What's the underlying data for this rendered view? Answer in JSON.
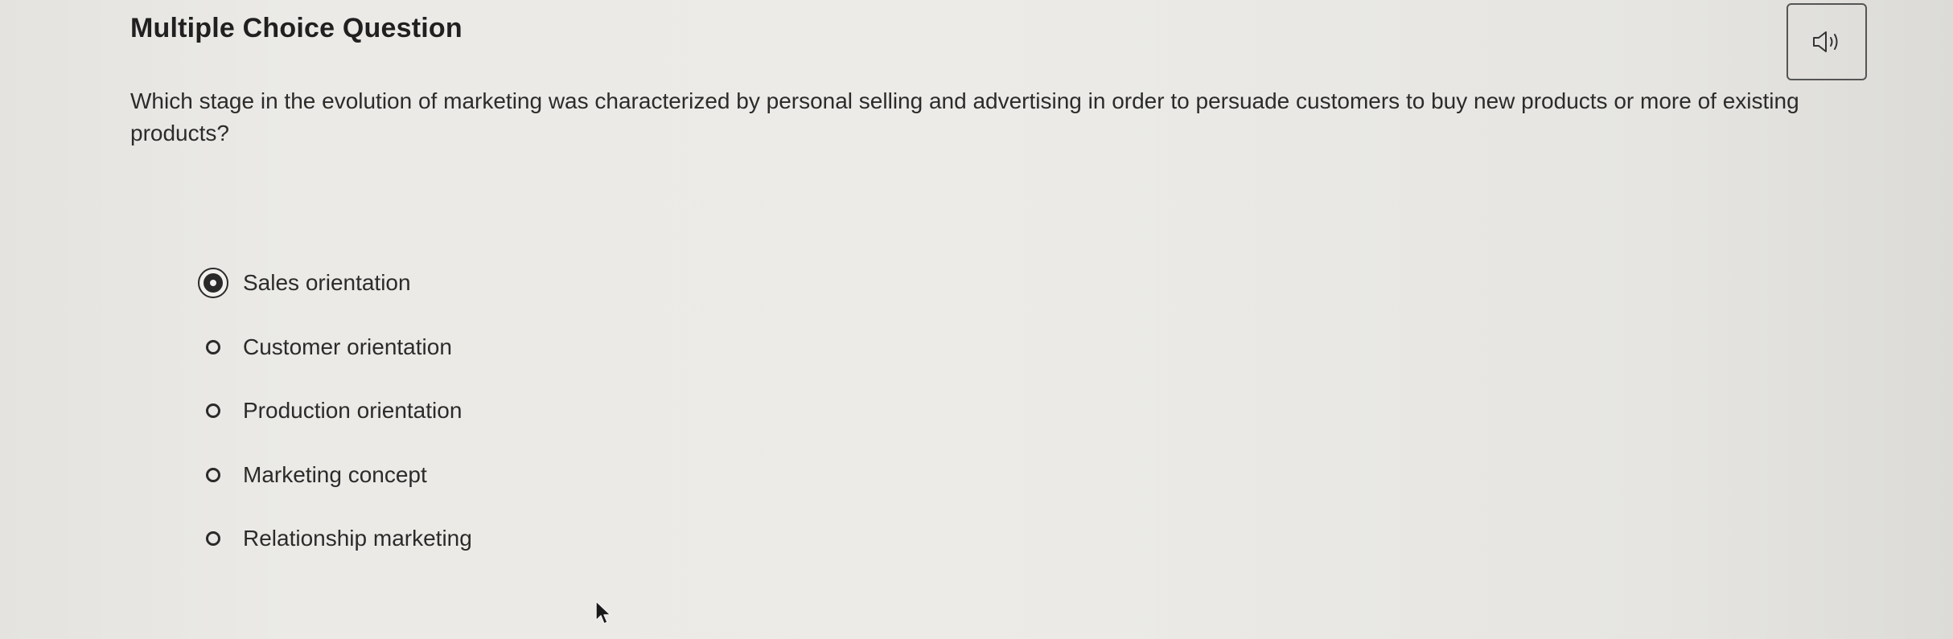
{
  "header": {
    "title": "Multiple Choice Question",
    "audio_icon": "speaker-icon"
  },
  "question": {
    "text": "Which stage in the evolution of marketing was characterized by personal selling and advertising in order to persuade customers to buy new products or more of existing products?"
  },
  "options": [
    {
      "label": "Sales orientation",
      "selected": true
    },
    {
      "label": "Customer orientation",
      "selected": false
    },
    {
      "label": "Production orientation",
      "selected": false
    },
    {
      "label": "Marketing concept",
      "selected": false
    },
    {
      "label": "Relationship marketing",
      "selected": false
    }
  ],
  "colors": {
    "text": "#2b2b2b",
    "background": "#ebeae6"
  }
}
